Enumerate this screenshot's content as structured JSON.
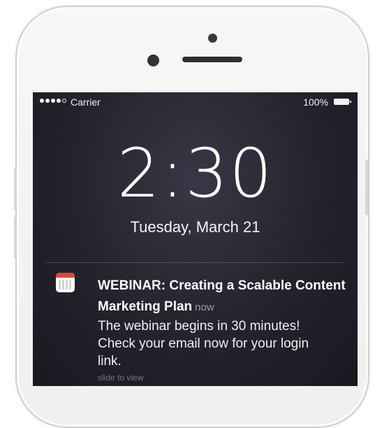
{
  "status_bar": {
    "carrier": "Carrier",
    "battery_percent": "100%",
    "signal_bars_filled": 4,
    "signal_bars_total": 5
  },
  "lock_screen": {
    "time": "2:30",
    "date": "Tuesday, March 21"
  },
  "notification": {
    "app_icon": "calendar-icon",
    "title": "WEBINAR: Creating a Scalable Content Marketing Plan",
    "time": "now",
    "body": "The webinar begins in 30 minutes! Check your email now for your login link.",
    "action_hint": "slide to view"
  },
  "colors": {
    "screen_background": "#24222c",
    "calendar_accent": "#e0463a",
    "phone_body": "#f3f3f3"
  }
}
